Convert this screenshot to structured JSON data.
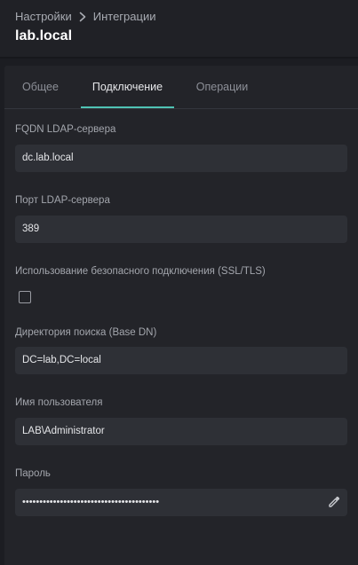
{
  "breadcrumb": {
    "parent": "Настройки",
    "current": "Интеграции"
  },
  "page": {
    "title": "lab.local"
  },
  "tabs": [
    {
      "label": "Общее",
      "active": false
    },
    {
      "label": "Подключение",
      "active": true
    },
    {
      "label": "Операции",
      "active": false
    }
  ],
  "form": {
    "fqdn": {
      "label": "FQDN LDAP-сервера",
      "value": "dc.lab.local"
    },
    "port": {
      "label": "Порт LDAP-сервера",
      "value": "389"
    },
    "ssl": {
      "label": "Использование безопасного подключения (SSL/TLS)",
      "checked": false
    },
    "base_dn": {
      "label": "Директория поиска (Base DN)",
      "value": "DC=lab,DC=local"
    },
    "username": {
      "label": "Имя пользователя",
      "value": "LAB\\Administrator"
    },
    "password": {
      "label": "Пароль",
      "value": "••••••••••••••••••••••••••••••••••••••••"
    }
  },
  "colors": {
    "accent": "#4fc3b4",
    "background": "#1c1d22",
    "panel": "#232429",
    "input": "#2e3036"
  },
  "icons": {
    "breadcrumb_separator": "chevron-right-icon",
    "password_edit": "pencil-icon"
  }
}
